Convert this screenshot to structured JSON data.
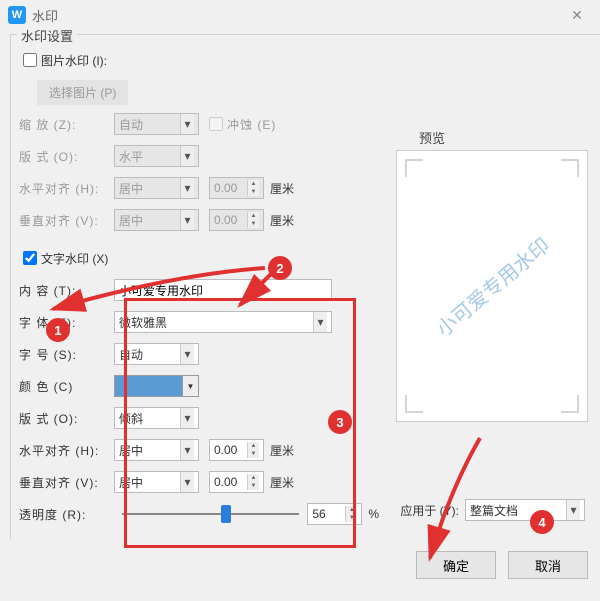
{
  "titlebar": {
    "title": "水印"
  },
  "fieldset_legend": "水印设置",
  "image_wm": {
    "checkbox_label": "图片水印 (I):",
    "select_pic_btn": "选择图片 (P)",
    "scale_label": "缩    放 (Z):",
    "scale_value": "自动",
    "washout_label": "冲蚀 (E)",
    "layout_label": "版    式 (O):",
    "layout_value": "水平",
    "halign_label": "水平对齐 (H):",
    "halign_value": "居中",
    "halign_num": "0.00",
    "halign_unit": "厘米",
    "valign_label": "垂直对齐 (V):",
    "valign_value": "居中",
    "valign_num": "0.00",
    "valign_unit": "厘米"
  },
  "text_wm": {
    "checkbox_label": "文字水印 (X)",
    "content_label": "内    容 (T):",
    "content_value": "小可爱专用水印",
    "font_label": "字    体 (F):",
    "font_value": "微软雅黑",
    "size_label": "字    号 (S):",
    "size_value": "自动",
    "color_label": "颜    色 (C)",
    "layout_label": "版    式 (O):",
    "layout_value": "倾斜",
    "halign_label": "水平对齐 (H):",
    "halign_value": "居中",
    "halign_num": "0.00",
    "halign_unit": "厘米",
    "valign_label": "垂直对齐 (V):",
    "valign_value": "居中",
    "valign_num": "0.00",
    "valign_unit": "厘米",
    "opacity_label": "透明度 (R):",
    "opacity_value": "56",
    "opacity_unit": "%"
  },
  "preview": {
    "label": "预览",
    "watermark_text": "小可爱专用水印"
  },
  "apply": {
    "label": "应用于 (Y):",
    "value": "整篇文档"
  },
  "buttons": {
    "ok": "确定",
    "cancel": "取消"
  },
  "annotations": {
    "b1": "1",
    "b2": "2",
    "b3": "3",
    "b4": "4"
  },
  "colors": {
    "accent": "#5b9bd5",
    "anno": "#e03030"
  }
}
